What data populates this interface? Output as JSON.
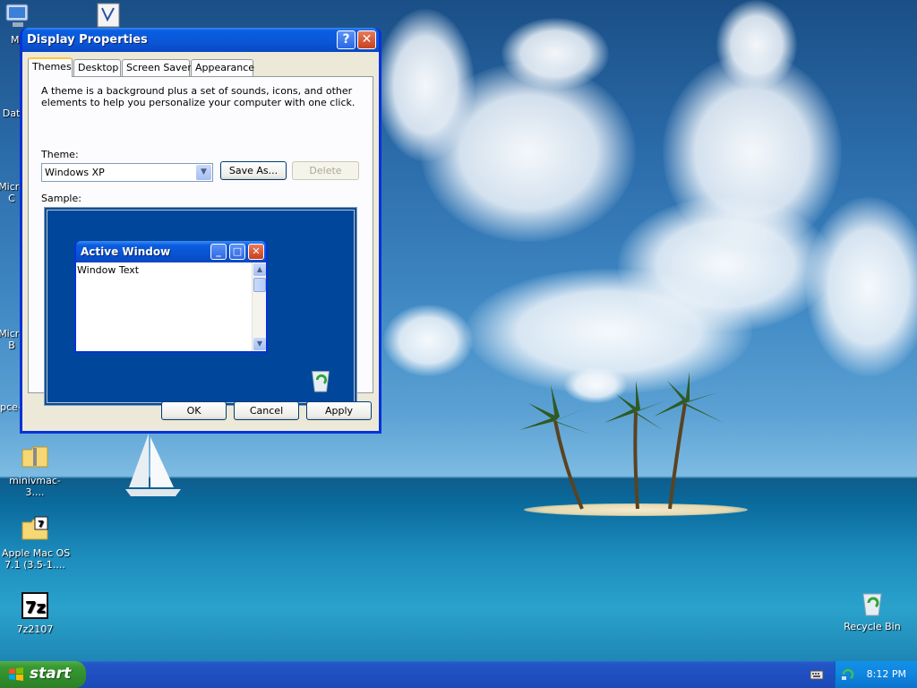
{
  "desktop": {
    "icons": [
      {
        "id": "my-computer",
        "label": "My",
        "icon": "computer-icon"
      },
      {
        "id": "shortcut-v",
        "label": "",
        "icon": "shortcut-icon"
      },
      {
        "id": "data",
        "label": "Data",
        "icon": "folder-icon"
      },
      {
        "id": "microsoft-1",
        "label": "Micro\nC",
        "icon": "app-icon"
      },
      {
        "id": "microsoft-2",
        "label": "Micro\nB",
        "icon": "app-icon"
      },
      {
        "id": "pce",
        "label": "pce-",
        "icon": "app-icon"
      },
      {
        "id": "minivmac",
        "label": "minivmac-3....",
        "icon": "zip-folder-icon"
      },
      {
        "id": "apple-mac-os",
        "label": "Apple Mac OS\n7.1 (3.5-1....",
        "icon": "7z-archive-icon"
      },
      {
        "id": "7z2107",
        "label": "7z2107",
        "icon": "7z-app-icon"
      },
      {
        "id": "recycle-bin",
        "label": "Recycle Bin",
        "icon": "recycle-bin-icon"
      }
    ]
  },
  "window": {
    "title": "Display Properties",
    "help_glyph": "?",
    "close_glyph": "✕",
    "tabs": [
      {
        "label": "Themes",
        "active": true
      },
      {
        "label": "Desktop",
        "active": false
      },
      {
        "label": "Screen Saver",
        "active": false
      },
      {
        "label": "Appearance",
        "active": false
      }
    ],
    "description": "A theme is a background plus a set of sounds, icons, and other elements to help you personalize your computer with one click.",
    "theme_label": "Theme:",
    "theme_value": "Windows XP",
    "save_as_label": "Save As...",
    "delete_label": "Delete",
    "sample_label": "Sample:",
    "sample": {
      "title": "Active Window",
      "body_text": "Window Text"
    },
    "ok_label": "OK",
    "cancel_label": "Cancel",
    "apply_label": "Apply"
  },
  "taskbar": {
    "start_label": "start",
    "clock": "8:12 PM"
  }
}
